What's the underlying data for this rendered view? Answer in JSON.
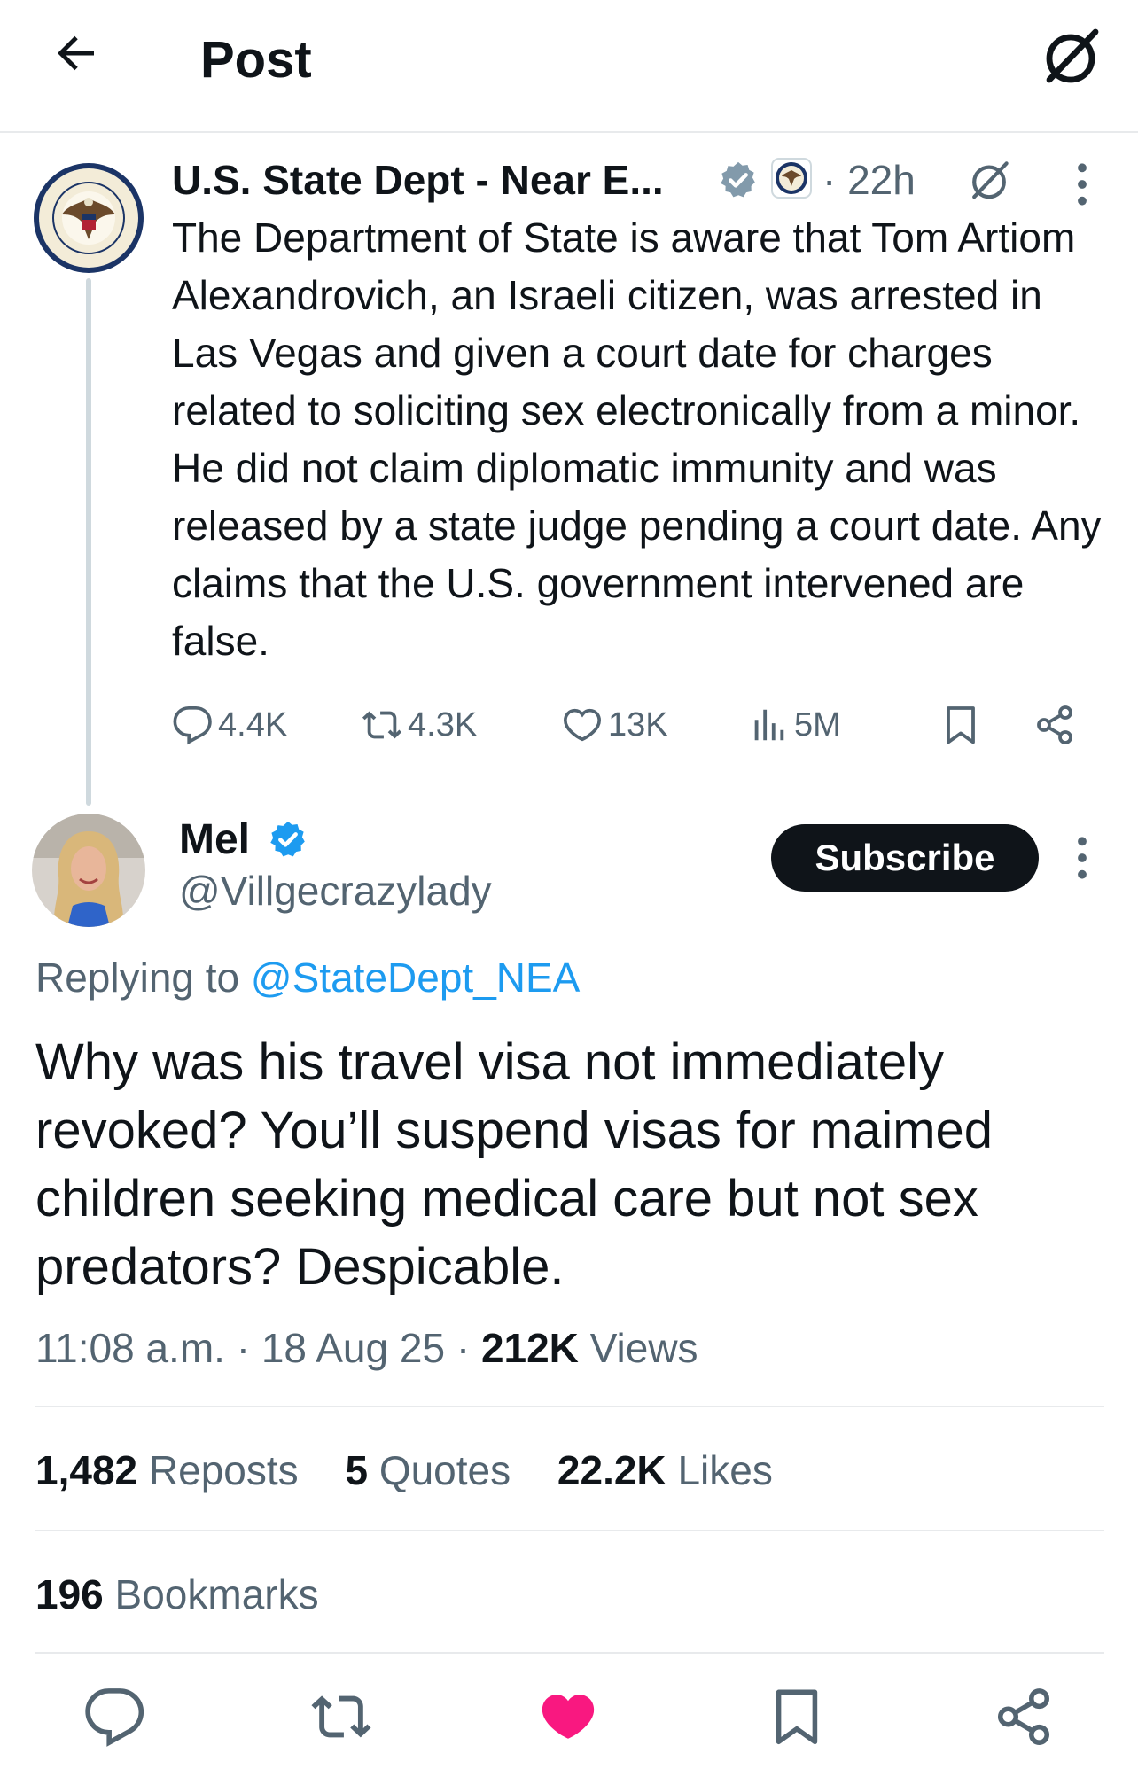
{
  "header": {
    "title": "Post",
    "back_icon": "arrow-left-icon",
    "grok_icon": "grok-icon"
  },
  "parent_post": {
    "display_name": "U.S. State Dept - Near E...",
    "time_sep": "· 22h",
    "text": "The Department of State is aware that Tom Artiom Alexandrovich, an Israeli citizen, was arrested in Las Vegas and given a court date for charges related to soliciting sex electronically from a minor. He did not claim diplomatic immunity and was released by a state judge pending a court date. Any claims that the U.S. government intervened are false.",
    "actions": {
      "replies": "4.4K",
      "reposts": "4.3K",
      "likes": "13K",
      "views": "5M"
    },
    "colors": {
      "verified": "#829aab"
    }
  },
  "reply_post": {
    "display_name": "Mel",
    "handle": "@Villgecrazylady",
    "subscribe_label": "Subscribe",
    "replying_prefix": "Replying to ",
    "replying_handle": "@StateDept_NEA",
    "text": "Why was his travel visa not immediately revoked? You’ll suspend visas for maimed children seeking medical care but not sex predators? Despicable.",
    "time": "11:08 a.m.",
    "date": "18 Aug 25",
    "views_count": "212K",
    "views_label": "Views",
    "stats": {
      "reposts_count": "1,482",
      "reposts_label": "Reposts",
      "quotes_count": "5",
      "quotes_label": "Quotes",
      "likes_count": "22.2K",
      "likes_label": "Likes",
      "bookmarks_count": "196",
      "bookmarks_label": "Bookmarks"
    },
    "colors": {
      "verified": "#1d9bf0",
      "like_active": "#f91880",
      "link": "#1d9bf0"
    }
  },
  "bottom_bar": {
    "icons": [
      "reply-icon",
      "repost-icon",
      "like-icon-filled",
      "bookmark-icon",
      "share-icon"
    ]
  }
}
